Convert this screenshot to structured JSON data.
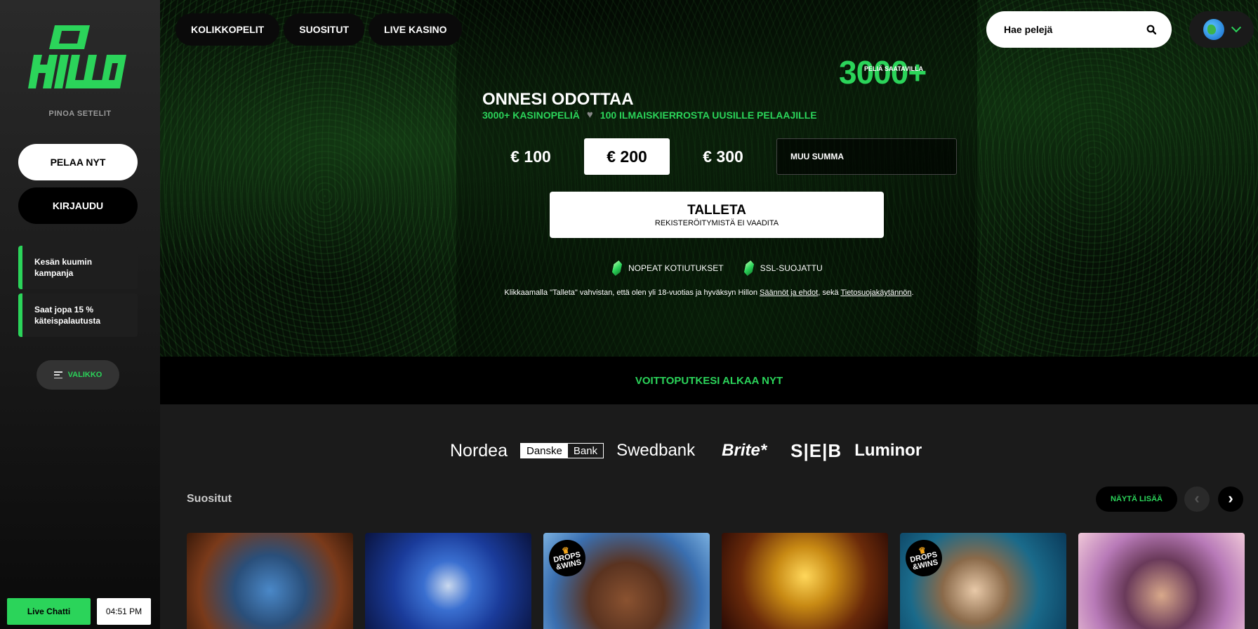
{
  "brand": {
    "name": "HILLO",
    "tagline": "PINOA SETELIT",
    "color": "#2bd45a"
  },
  "sidebar": {
    "play_label": "PELAA NYT",
    "login_label": "KIRJAUDU",
    "promos": [
      {
        "text": "Kesän kuumin kampanja"
      },
      {
        "text": "Saat jopa 15 % käteispalautusta"
      }
    ],
    "menu_label": "VALIKKO",
    "chat_label": "Live Chatti",
    "time": "04:51 PM"
  },
  "nav": {
    "items": [
      {
        "label": "KOLIKKOPELIT"
      },
      {
        "label": "SUOSITUT"
      },
      {
        "label": "LIVE KASINO"
      }
    ],
    "search_placeholder": "Hae pelejä"
  },
  "hero": {
    "count": "3000+",
    "count_sub": "PELIÄ SAATAVILLA",
    "headline": "ONNESI ODOTTAA",
    "sub_left": "3000+ KASINOPELIÄ",
    "sub_right": "100 ILMAISKIERROSTA UUSILLE PELAAJILLE",
    "amounts": [
      {
        "label": "€ 100"
      },
      {
        "label": "€ 200"
      },
      {
        "label": "€ 300"
      }
    ],
    "selected_amount": "€ 200",
    "custom_placeholder": "MUU SUMMA",
    "deposit_label": "TALLETA",
    "deposit_sub": "REKISTERÖITYMISTÄ EI VAADITA",
    "features": [
      {
        "label": "NOPEAT KOTIUTUKSET"
      },
      {
        "label": "SSL-SUOJATTU"
      }
    ],
    "legal_prefix": "Klikkaamalla \"Talleta\" vahvistan, että olen yli 18-vuotias ja hyväksyn Hillon ",
    "legal_link1": "Säännöt ja ehdot",
    "legal_mid": ", sekä ",
    "legal_link2": "Tietosuojakäytännön",
    "legal_suffix": "."
  },
  "banner": {
    "text": "VOITTOPUTKESI ALKAA NYT"
  },
  "banks": {
    "nordea": "Nordea",
    "danske_a": "Danske",
    "danske_b": "Bank",
    "swedbank": "Swedbank",
    "brite": "Brite*",
    "seb": "S|E|B",
    "luminor": "Luminor"
  },
  "popular": {
    "title": "Suositut",
    "show_more": "NÄYTÄ LISÄÄ",
    "badge_line1": "DROPS",
    "badge_line2": "&WINS",
    "games": [
      {
        "art": "blue-wolf"
      },
      {
        "art": "hooded-wizard"
      },
      {
        "art": "rottweiler",
        "badge": true
      },
      {
        "art": "golden-cobra"
      },
      {
        "art": "bearded-fisherman",
        "badge": true
      },
      {
        "art": "gangster-with-sunglasses"
      }
    ]
  }
}
